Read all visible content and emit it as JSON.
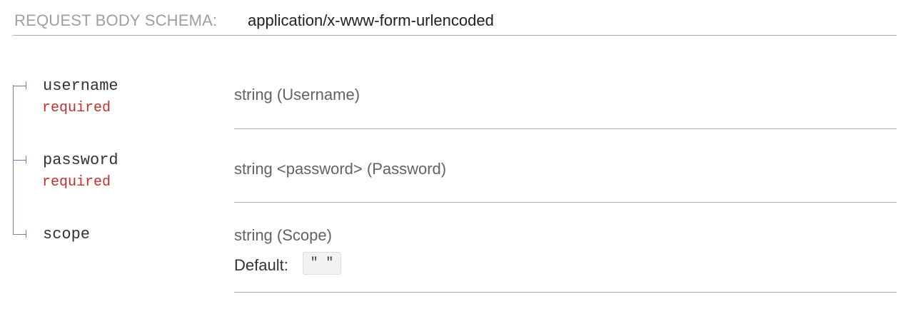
{
  "schema": {
    "label": "REQUEST BODY SCHEMA:",
    "content_type": "application/x-www-form-urlencoded"
  },
  "properties": [
    {
      "name": "username",
      "required_label": "required",
      "type": "string (Username)"
    },
    {
      "name": "password",
      "required_label": "required",
      "type": "string <password> (Password)"
    },
    {
      "name": "scope",
      "type": "string (Scope)",
      "default_label": "Default:",
      "default_value": "\" \""
    }
  ],
  "colors": {
    "required": "#c0312b",
    "tree_line": "#7c7ca6",
    "separator": "#a6adb2",
    "header_label": "#9aa0a4"
  }
}
